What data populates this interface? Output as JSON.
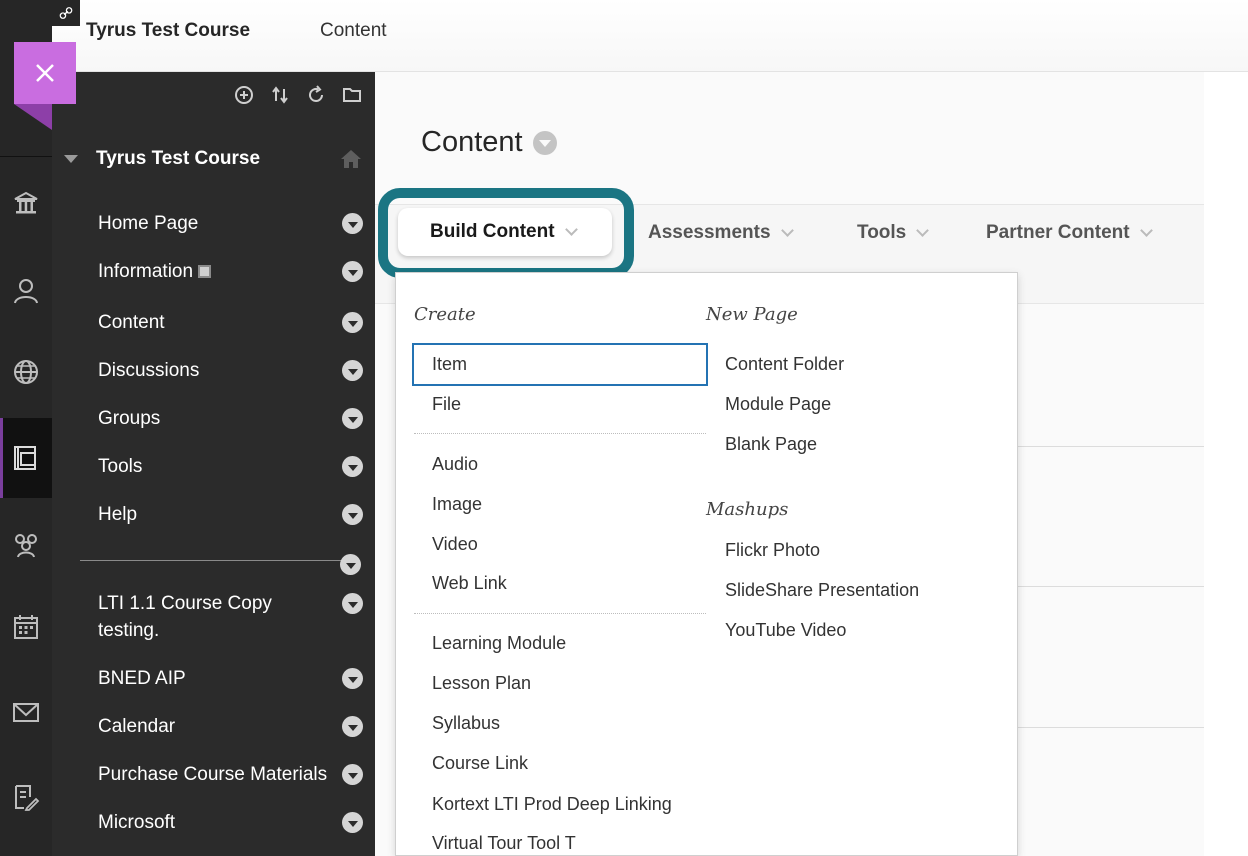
{
  "breadcrumb": {
    "course": "Tyrus Test Course",
    "page": "Content"
  },
  "rail": {
    "icons": [
      "institution-icon",
      "profile-icon",
      "globe-icon",
      "courses-icon",
      "groups-icon",
      "calendar-icon",
      "messages-icon",
      "grades-icon"
    ],
    "active": "courses-icon"
  },
  "close_tab": {
    "icon": "close-icon",
    "color": "#c96de0"
  },
  "course_menu": {
    "title": "Tyrus Test Course",
    "tools": [
      "add-menu-item-icon",
      "reorder-icon",
      "refresh-icon",
      "folder-view-icon"
    ],
    "items": [
      {
        "label": "Home Page"
      },
      {
        "label": "Information"
      },
      {
        "label": "Content"
      },
      {
        "label": "Discussions"
      },
      {
        "label": "Groups"
      },
      {
        "label": "Tools"
      },
      {
        "label": "Help"
      },
      {
        "label": "LTI 1.1 Course Copy testing."
      },
      {
        "label": "BNED AIP"
      },
      {
        "label": "Calendar"
      },
      {
        "label": "Purchase Course Materials"
      },
      {
        "label": "Microsoft"
      }
    ]
  },
  "page": {
    "title": "Content",
    "action_bar": {
      "build": "Build Content",
      "assessments": "Assessments",
      "tools": "Tools",
      "partner": "Partner Content"
    },
    "highlight_color": "#1b7583"
  },
  "dropdown": {
    "create_heading": "Create",
    "create_items_1": [
      "Item",
      "File"
    ],
    "create_items_2": [
      "Audio",
      "Image",
      "Video",
      "Web Link"
    ],
    "create_items_3": [
      "Learning Module",
      "Lesson Plan",
      "Syllabus",
      "Course Link",
      "Kortext LTI Prod Deep Linking",
      "Virtual Tour Tool T"
    ],
    "new_page_heading": "New Page",
    "new_page_items": [
      "Content Folder",
      "Module Page",
      "Blank Page"
    ],
    "mashups_heading": "Mashups",
    "mashups_items": [
      "Flickr Photo",
      "SlideShare Presentation",
      "YouTube Video"
    ],
    "selected": "Item"
  }
}
